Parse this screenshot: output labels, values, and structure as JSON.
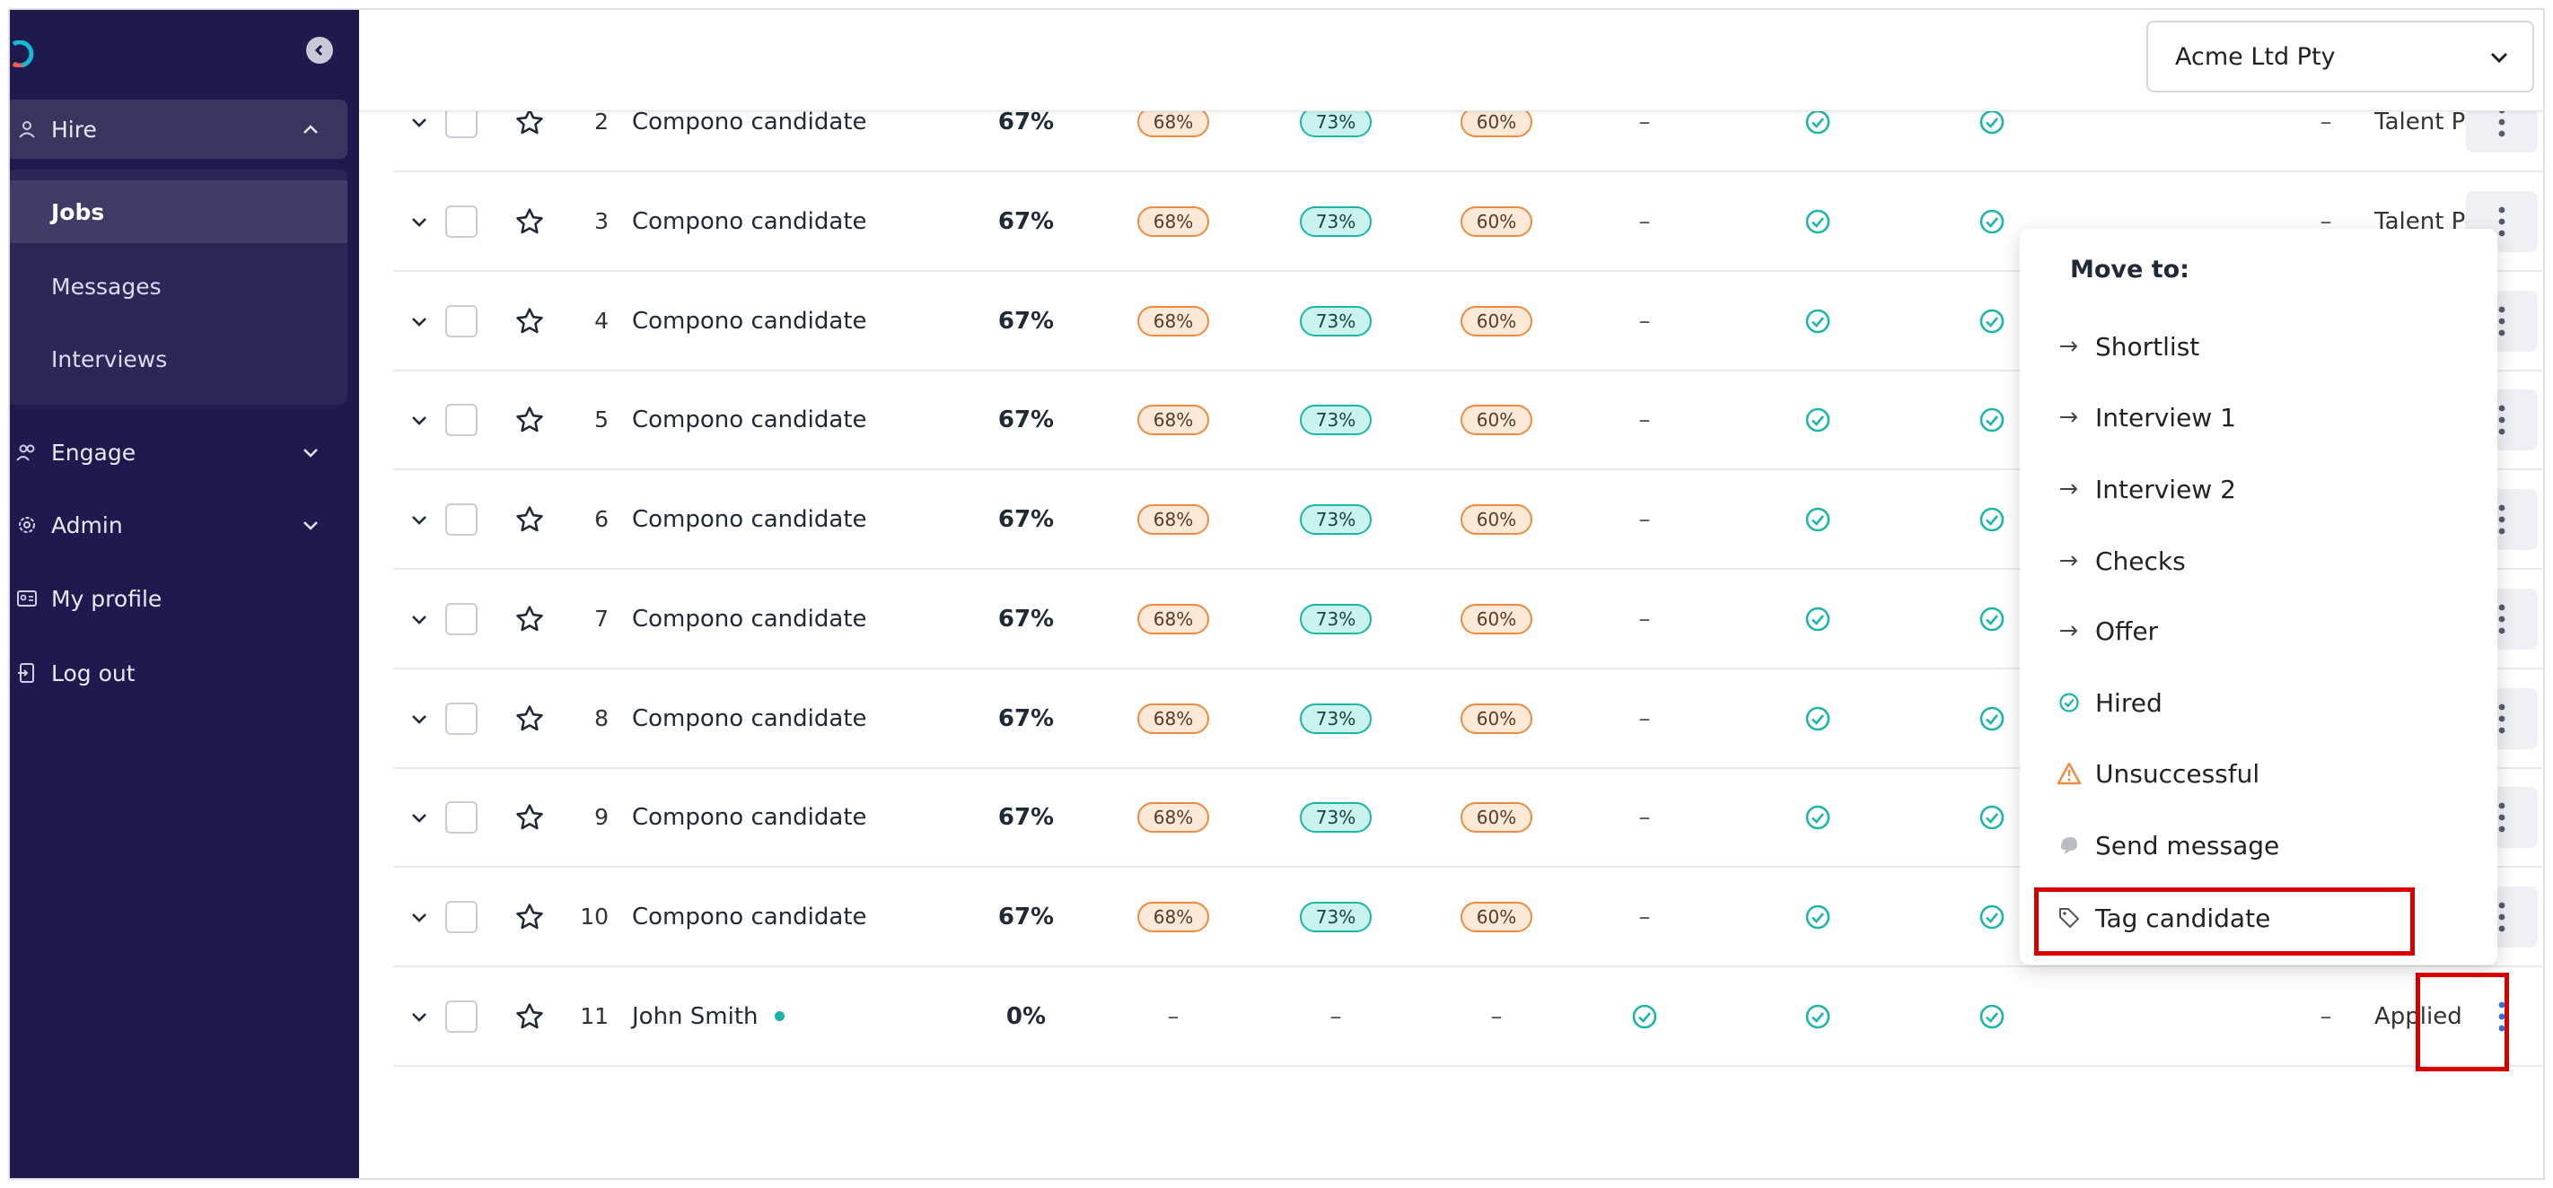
{
  "sidebar": {
    "hire_label": "Hire",
    "sub": {
      "jobs": "Jobs",
      "messages": "Messages",
      "interviews": "Interviews"
    },
    "engage_label": "Engage",
    "admin_label": "Admin",
    "profile_label": "My profile",
    "logout_label": "Log out"
  },
  "header": {
    "company": "Acme Ltd Pty"
  },
  "colors": {
    "sidebar": "#1e1a4d",
    "teal": "#19b7a7",
    "orange": "#f08a3e",
    "highlight": "#d60000",
    "menu_dots": "#2f6fd6"
  },
  "rows": [
    {
      "num": "2",
      "name": "Compono candidate",
      "total": "67%",
      "s1": "68%",
      "s2": "73%",
      "s3": "60%",
      "dash": "–",
      "status": "Talent Pool"
    },
    {
      "num": "3",
      "name": "Compono candidate",
      "total": "67%",
      "s1": "68%",
      "s2": "73%",
      "s3": "60%",
      "dash": "–",
      "status": "Talent Pool"
    },
    {
      "num": "4",
      "name": "Compono candidate",
      "total": "67%",
      "s1": "68%",
      "s2": "73%",
      "s3": "60%",
      "dash": "–",
      "status": ""
    },
    {
      "num": "5",
      "name": "Compono candidate",
      "total": "67%",
      "s1": "68%",
      "s2": "73%",
      "s3": "60%",
      "dash": "–",
      "status": ""
    },
    {
      "num": "6",
      "name": "Compono candidate",
      "total": "67%",
      "s1": "68%",
      "s2": "73%",
      "s3": "60%",
      "dash": "–",
      "status": ""
    },
    {
      "num": "7",
      "name": "Compono candidate",
      "total": "67%",
      "s1": "68%",
      "s2": "73%",
      "s3": "60%",
      "dash": "–",
      "status": ""
    },
    {
      "num": "8",
      "name": "Compono candidate",
      "total": "67%",
      "s1": "68%",
      "s2": "73%",
      "s3": "60%",
      "dash": "–",
      "status": ""
    },
    {
      "num": "9",
      "name": "Compono candidate",
      "total": "67%",
      "s1": "68%",
      "s2": "73%",
      "s3": "60%",
      "dash": "–",
      "status": ""
    },
    {
      "num": "10",
      "name": "Compono candidate",
      "total": "67%",
      "s1": "68%",
      "s2": "73%",
      "s3": "60%",
      "dash": "–",
      "status": ""
    },
    {
      "num": "11",
      "name": "John Smith",
      "total": "0%",
      "s1": "–",
      "s2": "–",
      "s3": "–",
      "dash": "–",
      "status": "Applied"
    }
  ],
  "menu": {
    "title": "Move to:",
    "items": [
      {
        "label": "Shortlist",
        "icon": "arrow-right-icon"
      },
      {
        "label": "Interview 1",
        "icon": "arrow-right-icon"
      },
      {
        "label": "Interview 2",
        "icon": "arrow-right-icon"
      },
      {
        "label": "Checks",
        "icon": "arrow-right-icon"
      },
      {
        "label": "Offer",
        "icon": "arrow-right-icon"
      },
      {
        "label": "Hired",
        "icon": "check-circle-icon"
      },
      {
        "label": "Unsuccessful",
        "icon": "warning-icon"
      },
      {
        "label": "Send message",
        "icon": "chat-bubble-icon"
      },
      {
        "label": "Tag candidate",
        "icon": "tag-icon"
      }
    ]
  }
}
